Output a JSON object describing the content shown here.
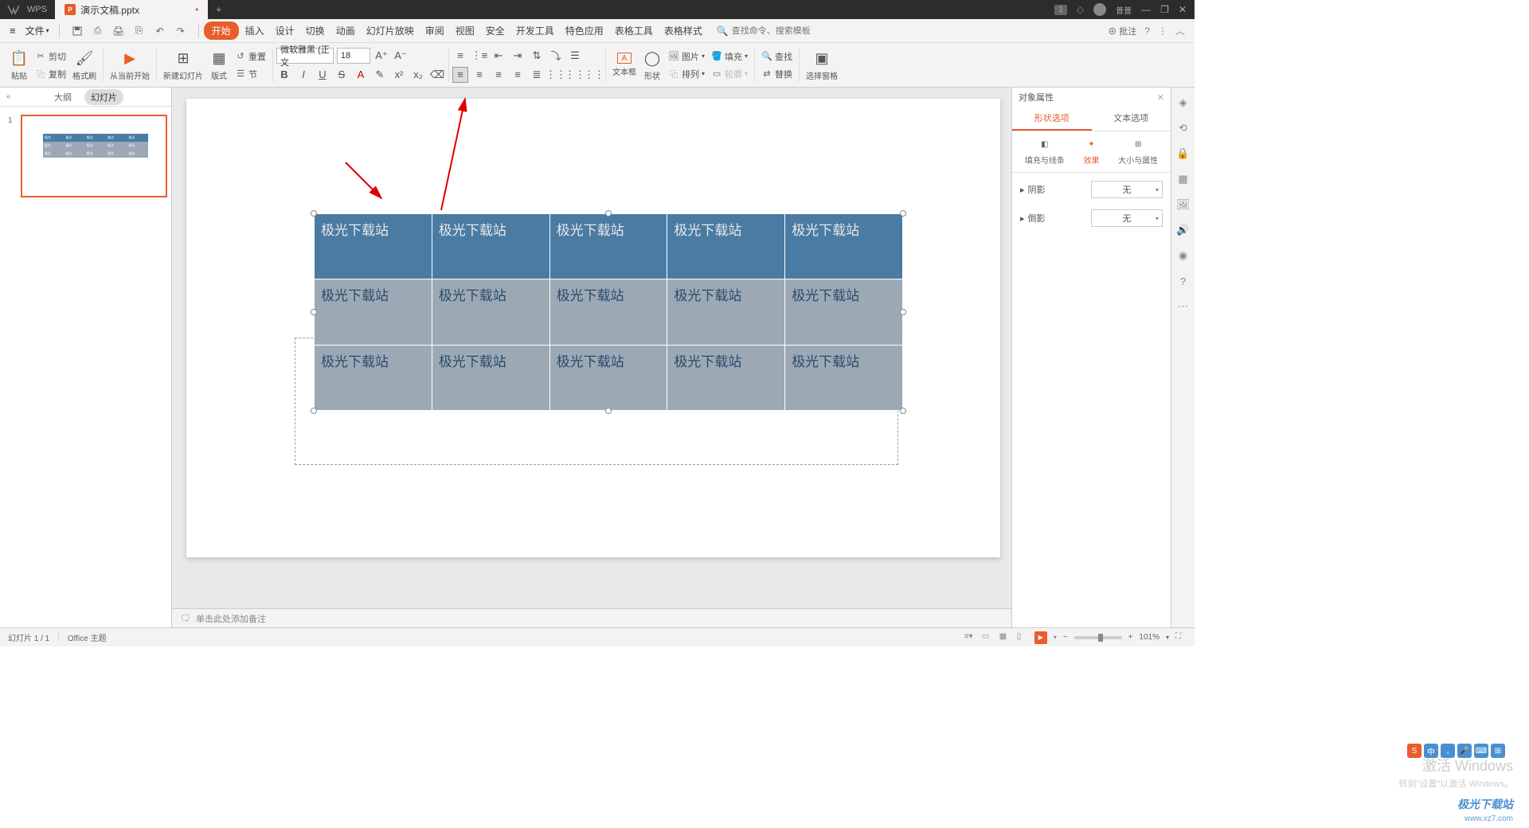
{
  "titlebar": {
    "app": "WPS",
    "tab_label": "演示文稿.pptx",
    "tab_dirty": "•",
    "newtab": "+",
    "badge": "1",
    "user": "普普"
  },
  "menubar": {
    "file": "文件",
    "items": [
      "开始",
      "插入",
      "设计",
      "切换",
      "动画",
      "幻灯片放映",
      "审阅",
      "视图",
      "安全",
      "开发工具",
      "特色应用",
      "表格工具",
      "表格样式"
    ],
    "search_icon": "🔍",
    "search_placeholder": "查找命令、搜索模板",
    "annotate": "批注",
    "help": "?"
  },
  "ribbon": {
    "paste": "粘贴",
    "cut": "剪切",
    "copy": "复制",
    "format_painter": "格式刷",
    "from_current": "从当前开始",
    "new_slide": "新建幻灯片",
    "layout": "版式",
    "reset": "重置",
    "section": "节",
    "font_name": "微软雅黑 (正文",
    "font_size": "18",
    "textbox": "文本框",
    "shape": "形状",
    "picture": "图片",
    "arrange": "排列",
    "fill": "填充",
    "outline": "轮廓",
    "find": "查找",
    "replace": "替换",
    "select_pane": "选择窗格"
  },
  "leftpanel": {
    "tab_outline": "大纲",
    "tab_slides": "幻灯片",
    "slide_num": "1"
  },
  "table_cell": "极光下载站",
  "notes": "单击此处添加备注",
  "rightpanel": {
    "title": "对象属性",
    "tab_shape": "形状选项",
    "tab_text": "文本选项",
    "sub_fill": "填充与线条",
    "sub_effect": "效果",
    "sub_size": "大小与属性",
    "prop_shadow": "阴影",
    "prop_bevel": "倒影",
    "value_none": "无"
  },
  "statusbar": {
    "slide_info": "幻灯片 1 / 1",
    "theme": "Office 主题",
    "zoom": "101%"
  },
  "watermark": {
    "line1": "激活 Windows",
    "line2": "转到\"设置\"以激活 Windows。",
    "brand": "极光下载站",
    "url": "www.xz7.com"
  },
  "ime": {
    "s": "S",
    "cn": "中"
  }
}
